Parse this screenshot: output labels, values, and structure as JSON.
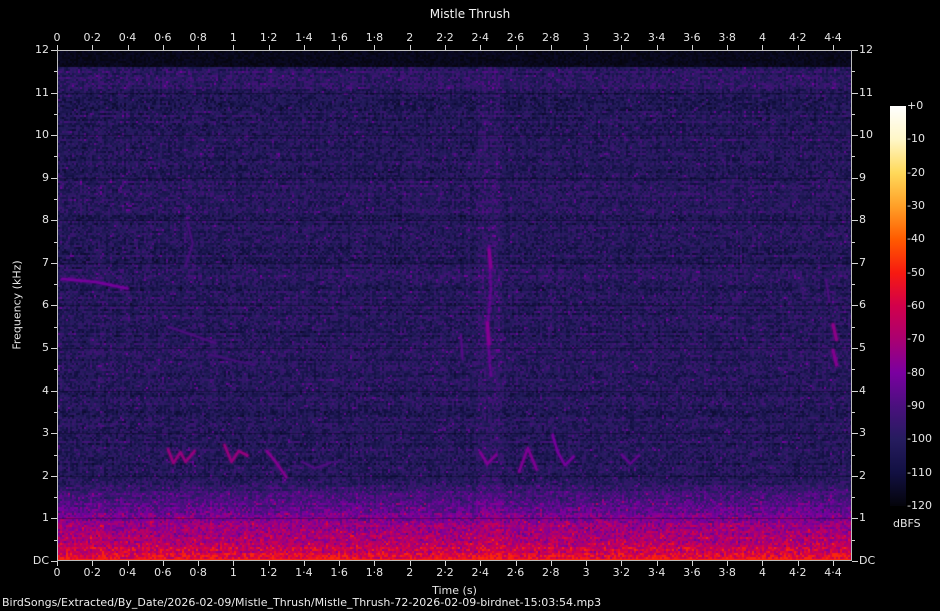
{
  "title": "Mistle Thrush",
  "file_path": "BirdSongs/Extracted/By_Date/2026-02-09/Mistle_Thrush/Mistle_Thrush-72-2026-02-09-birdnet-15:03:54.mp3",
  "chart_data": {
    "type": "heatmap",
    "subtype": "audio-spectrogram",
    "title": "Mistle Thrush",
    "xlabel": "Time (s)",
    "ylabel": "Frequency (kHz)",
    "colorbar_label": "dBFS",
    "x_range_s": [
      0,
      4.51
    ],
    "y_range_khz": [
      0,
      12
    ],
    "db_range": [
      -120,
      0
    ],
    "grid": "faint horizontal lines at each kHz",
    "legend_position": "right colorbar",
    "x_ticks": {
      "values": [
        0,
        0.2,
        0.4,
        0.6,
        0.8,
        1,
        1.2,
        1.4,
        1.6,
        1.8,
        2,
        2.2,
        2.4,
        2.6,
        2.8,
        3,
        3.2,
        3.4,
        3.6,
        3.8,
        4,
        4.2,
        4.4
      ],
      "labels": [
        "0",
        "0·2",
        "0·4",
        "0·6",
        "0·8",
        "1",
        "1·2",
        "1·4",
        "1·6",
        "1·8",
        "2",
        "2·2",
        "2·4",
        "2·6",
        "2·8",
        "3",
        "3·2",
        "3·4",
        "3·6",
        "3·8",
        "4",
        "4·2",
        "4·4"
      ],
      "shown_top_and_bottom": true
    },
    "y_ticks": {
      "values": [
        12,
        11,
        10,
        9,
        8,
        7,
        6,
        5,
        4,
        3,
        2,
        1,
        0
      ],
      "labels": [
        "12",
        "11",
        "10",
        "9",
        "8",
        "7",
        "6",
        "5",
        "4",
        "3",
        "2",
        "1",
        "DC"
      ],
      "minor_values": [
        11.5,
        10.5,
        9.5,
        8.5,
        7.5,
        6.5,
        5.5,
        4.5,
        3.5,
        2.5,
        1.5,
        0.5
      ],
      "shown_left_and_right": true
    },
    "colorbar": {
      "labels": [
        "+0",
        "-10",
        "-20",
        "-30",
        "-40",
        "-50",
        "-60",
        "-70",
        "-80",
        "-90",
        "-100",
        "-110",
        "-120"
      ],
      "db_values": [
        0,
        -10,
        -20,
        -30,
        -40,
        -50,
        -60,
        -70,
        -80,
        -90,
        -100,
        -110,
        -120
      ]
    },
    "palette": [
      {
        "db": 0,
        "color": "#ffffff"
      },
      {
        "db": -10,
        "color": "#fff7c8"
      },
      {
        "db": -20,
        "color": "#ffd95a"
      },
      {
        "db": -30,
        "color": "#ffa028"
      },
      {
        "db": -40,
        "color": "#ff5b00"
      },
      {
        "db": -50,
        "color": "#f71a10"
      },
      {
        "db": -60,
        "color": "#d2004b"
      },
      {
        "db": -70,
        "color": "#aa0071"
      },
      {
        "db": -80,
        "color": "#7a00a0"
      },
      {
        "db": -90,
        "color": "#4a107e"
      },
      {
        "db": -100,
        "color": "#261c5f"
      },
      {
        "db": -110,
        "color": "#121042"
      },
      {
        "db": -120,
        "color": "#04040a"
      }
    ],
    "noise_model": {
      "noise_floor_db": -102,
      "noise_spread_db": 8,
      "empty_above_khz": 11.62,
      "bright_top_band_khz": [
        11.1,
        11.62
      ],
      "low_band_cutoff_khz": 1.9,
      "low_band_max_boost_db": 46,
      "bottom_extra_boost_below_khz": 0.15,
      "call_column_time_s": [
        2.39,
        2.53
      ]
    },
    "features": [
      {
        "name": "intro-whistle",
        "db": -80,
        "w": 2.5,
        "pts": [
          [
            0.03,
            6.62
          ],
          [
            0.22,
            6.55
          ],
          [
            0.4,
            6.4
          ]
        ]
      },
      {
        "name": "faint-diagonal-1",
        "db": -89,
        "w": 2,
        "pts": [
          [
            0.63,
            5.5
          ],
          [
            0.9,
            5.12
          ]
        ]
      },
      {
        "name": "faint-diagonal-2",
        "db": -91,
        "w": 2,
        "pts": [
          [
            0.86,
            4.85
          ],
          [
            1.12,
            4.6
          ]
        ]
      },
      {
        "name": "faint-vertical-squiggle",
        "db": -90,
        "w": 2,
        "pts": [
          [
            0.74,
            7.95
          ],
          [
            0.77,
            7.45
          ],
          [
            0.73,
            6.95
          ]
        ]
      },
      {
        "name": "song-note-1",
        "db": -73,
        "w": 2.5,
        "pts": [
          [
            0.63,
            2.62
          ],
          [
            0.66,
            2.3
          ],
          [
            0.7,
            2.55
          ],
          [
            0.73,
            2.33
          ],
          [
            0.78,
            2.58
          ]
        ]
      },
      {
        "name": "song-note-2",
        "db": -73,
        "w": 2.5,
        "pts": [
          [
            0.95,
            2.72
          ],
          [
            0.99,
            2.33
          ],
          [
            1.03,
            2.58
          ],
          [
            1.08,
            2.48
          ]
        ]
      },
      {
        "name": "song-note-3",
        "db": -77,
        "w": 2.5,
        "pts": [
          [
            1.19,
            2.58
          ],
          [
            1.24,
            2.33
          ],
          [
            1.3,
            1.97
          ]
        ]
      },
      {
        "name": "song-note-4",
        "db": -88,
        "w": 2,
        "pts": [
          [
            1.39,
            2.33
          ],
          [
            1.46,
            2.18
          ],
          [
            1.55,
            2.3
          ]
        ]
      },
      {
        "name": "call-vertical",
        "db": -84,
        "w": 2.5,
        "dash": [
          4,
          3
        ],
        "pts": [
          [
            2.45,
            7.4
          ],
          [
            2.46,
            6.4
          ],
          [
            2.44,
            5.4
          ],
          [
            2.46,
            4.35
          ]
        ]
      },
      {
        "name": "call-bright-upper",
        "db": -77,
        "w": 3,
        "pts": [
          [
            2.45,
            7.3
          ],
          [
            2.46,
            6.9
          ]
        ]
      },
      {
        "name": "call-bright-lower",
        "db": -77,
        "w": 3,
        "pts": [
          [
            2.44,
            5.6
          ],
          [
            2.45,
            5.1
          ]
        ]
      },
      {
        "name": "short-vertical",
        "db": -87,
        "w": 2,
        "pts": [
          [
            2.29,
            5.3
          ],
          [
            2.3,
            4.75
          ]
        ]
      },
      {
        "name": "song-note-5",
        "db": -78,
        "w": 2.5,
        "pts": [
          [
            2.4,
            2.55
          ],
          [
            2.44,
            2.28
          ],
          [
            2.49,
            2.5
          ]
        ]
      },
      {
        "name": "song-note-6",
        "db": -78,
        "w": 2.5,
        "pts": [
          [
            2.62,
            2.1
          ],
          [
            2.67,
            2.65
          ],
          [
            2.72,
            2.15
          ]
        ]
      },
      {
        "name": "song-note-7",
        "db": -80,
        "w": 2.5,
        "pts": [
          [
            2.81,
            2.95
          ],
          [
            2.84,
            2.55
          ],
          [
            2.88,
            2.25
          ],
          [
            2.93,
            2.45
          ]
        ]
      },
      {
        "name": "song-note-8",
        "db": -84,
        "w": 2,
        "pts": [
          [
            3.2,
            2.5
          ],
          [
            3.25,
            2.28
          ],
          [
            3.3,
            2.48
          ]
        ]
      },
      {
        "name": "edge-blob-1",
        "db": -75,
        "w": 3,
        "pts": [
          [
            4.4,
            5.55
          ],
          [
            4.42,
            5.2
          ]
        ]
      },
      {
        "name": "edge-blob-2",
        "db": -77,
        "w": 3,
        "pts": [
          [
            4.4,
            4.95
          ],
          [
            4.42,
            4.6
          ]
        ]
      },
      {
        "name": "edge-streak",
        "db": -89,
        "w": 2,
        "pts": [
          [
            4.36,
            6.6
          ],
          [
            4.38,
            6.1
          ]
        ]
      }
    ]
  }
}
